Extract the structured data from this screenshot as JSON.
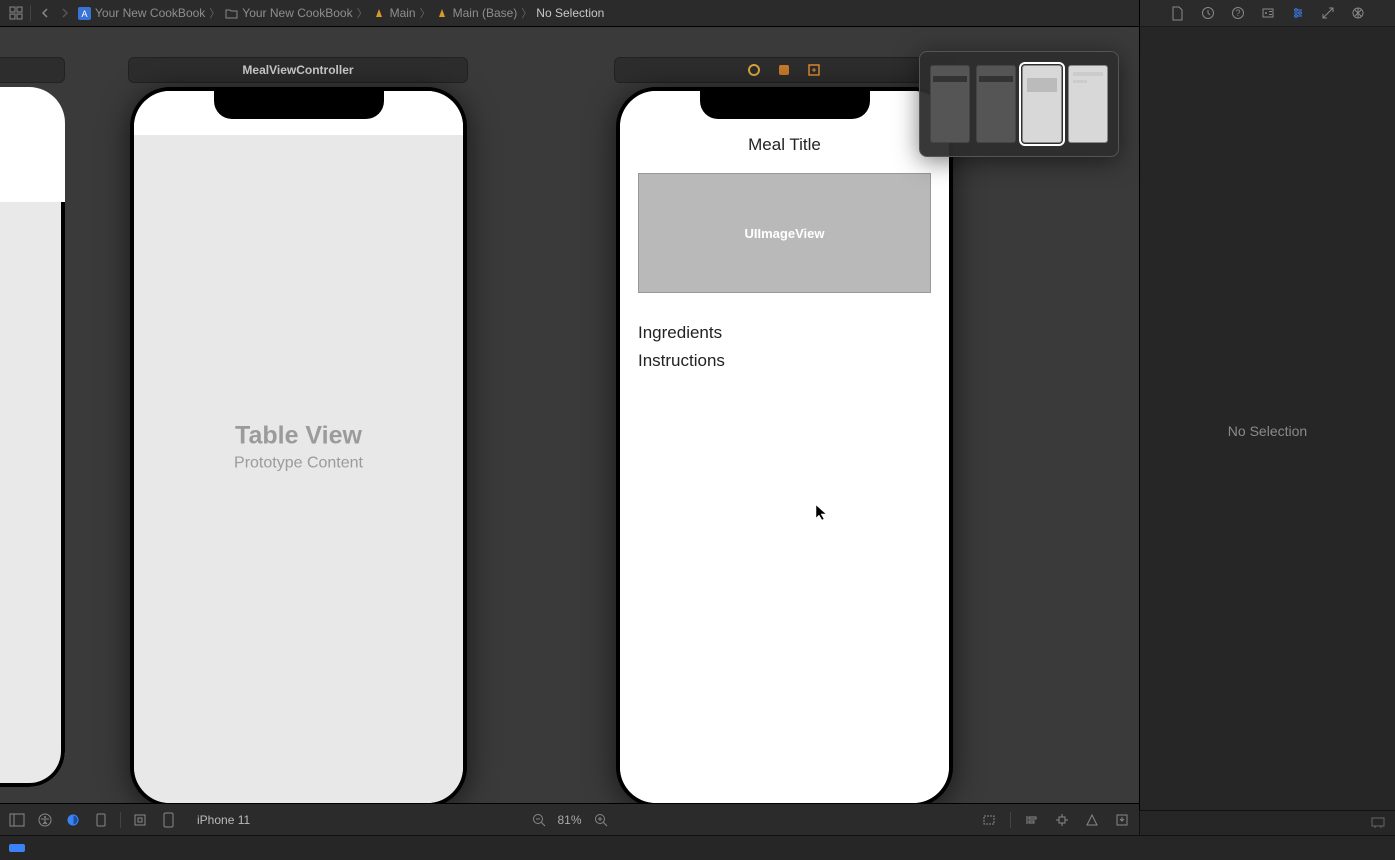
{
  "breadcrumbs": {
    "project": "Your New CookBook",
    "group": "Your New CookBook",
    "file": "Main",
    "variant": "Main (Base)",
    "selection": "No Selection"
  },
  "canvas": {
    "scene_a_title": "MealViewController",
    "scene_a_table_label": "Table View",
    "scene_a_prototype": "Prototype Content",
    "scene_b_meal_title": "Meal Title",
    "scene_b_imageview": "UIImageView",
    "scene_b_ingredients": "Ingredients",
    "scene_b_instructions": "Instructions"
  },
  "bottom_bar": {
    "device_name": "iPhone 11",
    "zoom_level": "81%"
  },
  "inspector": {
    "no_selection": "No Selection"
  },
  "icons": {
    "grid": "grid-icon",
    "back": "chevron-left-icon",
    "forward": "chevron-right-icon",
    "issues": "warning-icon"
  }
}
